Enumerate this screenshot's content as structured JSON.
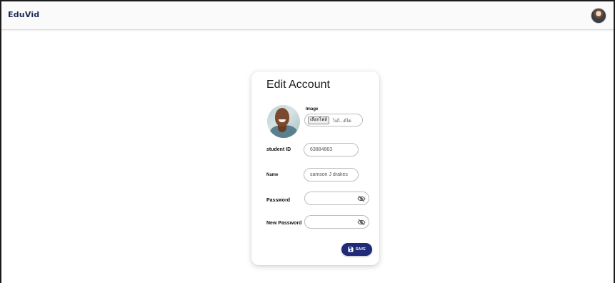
{
  "app": {
    "brand": "EduVid"
  },
  "header": {
    "avatar_icon": "user-avatar"
  },
  "card": {
    "title": "Edit Account",
    "image": {
      "label": "Image",
      "choose_button": "เลือกไฟล์",
      "status": "ไม่ไ...ด้ได"
    },
    "fields": {
      "student_id": {
        "label": "student ID",
        "value": "63884863",
        "placeholder": ""
      },
      "name": {
        "label": "Name",
        "value": "samson J drakes",
        "placeholder": ""
      },
      "password": {
        "label": "Password",
        "value": "",
        "toggle_icon": "eye-slash-icon"
      },
      "new_password": {
        "label": "New Password",
        "value": "",
        "toggle_icon": "eye-slash-icon"
      }
    },
    "save_button": {
      "label": "SAVE",
      "icon": "floppy-disk-icon"
    }
  },
  "colors": {
    "brand_text": "#1e2a5a",
    "save_button_bg": "#1f2b78",
    "topbar_bg": "#fafafa"
  }
}
